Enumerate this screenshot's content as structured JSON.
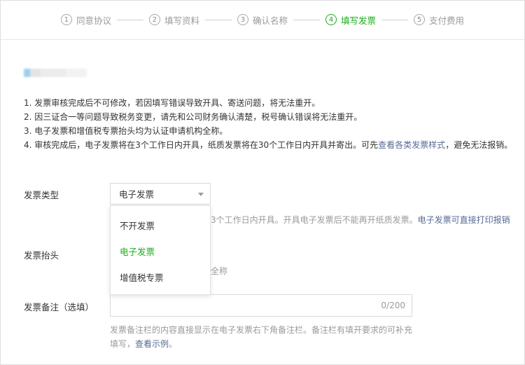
{
  "steps": [
    {
      "num": "1",
      "label": "同意协议"
    },
    {
      "num": "2",
      "label": "填写资料"
    },
    {
      "num": "3",
      "label": "确认名称"
    },
    {
      "num": "4",
      "label": "填写发票",
      "active": true
    },
    {
      "num": "5",
      "label": "支付费用"
    }
  ],
  "notes": {
    "n1": "1. 发票审核完成后不可修改，若因填写错误导致开具、寄送问题，将无法重开。",
    "n2": "2. 因三证合一等问题导致税务变更，请先和公司财务确认清楚，税号确认错误将无法重开。",
    "n3": "3. 电子发票和增值税专票抬头均为认证申请机构全称。",
    "n4_pre": "4. 审核完成后，电子发票将在3个工作日内开具，纸质发票将在30个工作日内开具并寄出。可先",
    "n4_link": "查看各类发票样式",
    "n4_post": "，避免无法报销。"
  },
  "invoice_type": {
    "label": "发票类型",
    "selected": "电子发票",
    "hint_pre": "3个工作日内开具。开具电子发票后不能再开纸质发票。",
    "hint_link": "电子发票可直接打印报销",
    "options": [
      "不开发票",
      "电子发票",
      "增值税专票"
    ]
  },
  "invoice_title": {
    "label": "发票抬头",
    "hint": "全称"
  },
  "invoice_remark": {
    "label": "发票备注（选填）",
    "counter": "0/200",
    "note_pre": "发票备注栏的内容直接显示在电子发票右下角备注栏。备注栏有填开要求的可补充填写，",
    "note_link": "查看示例",
    "note_post": "。"
  },
  "colors": {
    "accent": "#1aad19",
    "link": "#576b95"
  }
}
